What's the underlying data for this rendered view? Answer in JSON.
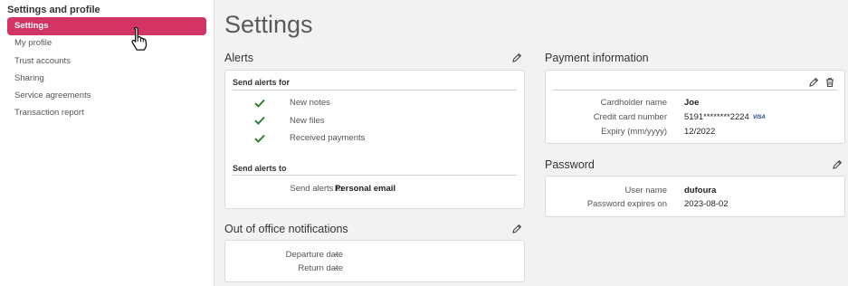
{
  "sidebar": {
    "heading": "Settings and profile",
    "items": [
      {
        "label": "Settings"
      },
      {
        "label": "My profile"
      },
      {
        "label": "Trust accounts"
      },
      {
        "label": "Sharing"
      },
      {
        "label": "Service agreements"
      },
      {
        "label": "Transaction report"
      }
    ]
  },
  "page": {
    "title": "Settings"
  },
  "alerts": {
    "title": "Alerts",
    "send_for_heading": "Send alerts for",
    "items": [
      "New notes",
      "New files",
      "Received payments"
    ],
    "send_to_heading": "Send alerts to",
    "send_to_label": "Send alerts to",
    "send_to_value": "Personal email"
  },
  "out_of_office": {
    "title": "Out of office notifications",
    "departure_label": "Departure date",
    "departure_value": "-",
    "return_label": "Return date",
    "return_value": "-"
  },
  "payment": {
    "title": "Payment information",
    "cardholder_label": "Cardholder name",
    "cardholder_value": "Joe",
    "card_label": "Credit card number",
    "card_value": "5191********2224",
    "card_brand": "VISA",
    "expiry_label": "Expiry (mm/yyyy)",
    "expiry_value": "12/2022"
  },
  "password": {
    "title": "Password",
    "username_label": "User name",
    "username_value": "dufoura",
    "expires_label": "Password expires on",
    "expires_value": "2023-08-02"
  },
  "colors": {
    "accent": "#d23463",
    "check": "#2e7d32"
  }
}
